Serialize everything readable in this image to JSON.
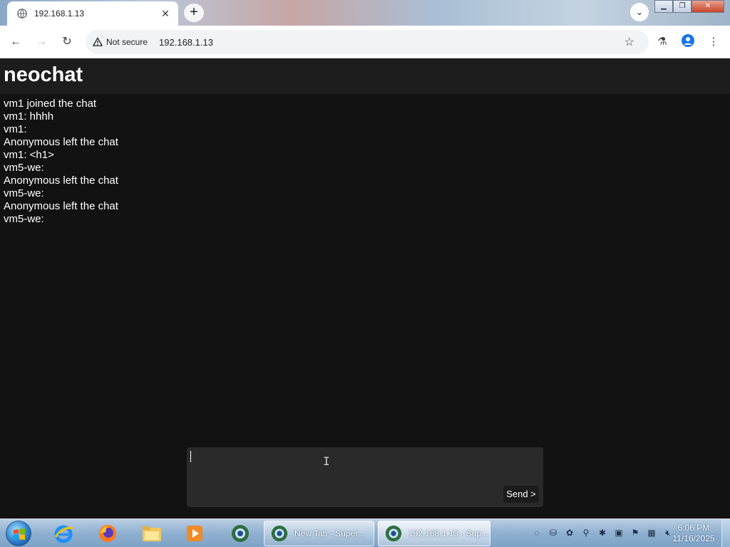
{
  "browser": {
    "tab_title": "192.168.1.13",
    "security_label": "Not secure",
    "url": "192.168.1.13"
  },
  "app": {
    "title": "neochat",
    "messages": [
      "vm1 joined the chat",
      "vm1: hhhh",
      "vm1: ",
      "Anonymous left the chat",
      "vm1: <h1>",
      "vm5-we: ",
      "Anonymous left the chat",
      "vm5-we: ",
      "Anonymous left the chat",
      "vm5-we: "
    ],
    "input_value": "",
    "send_label": "Send >"
  },
  "taskbar": {
    "windows": [
      {
        "label": "New Tab - Super..."
      },
      {
        "label": "192.168.1.13 - Sup..."
      }
    ],
    "clock_time": "6:06 PM",
    "clock_date": "11/16/2025"
  },
  "colors": {
    "page_bg": "#121212",
    "header_bg": "#1d1d1d",
    "composer_bg": "#2a2a2a",
    "text": "#ffffff"
  }
}
